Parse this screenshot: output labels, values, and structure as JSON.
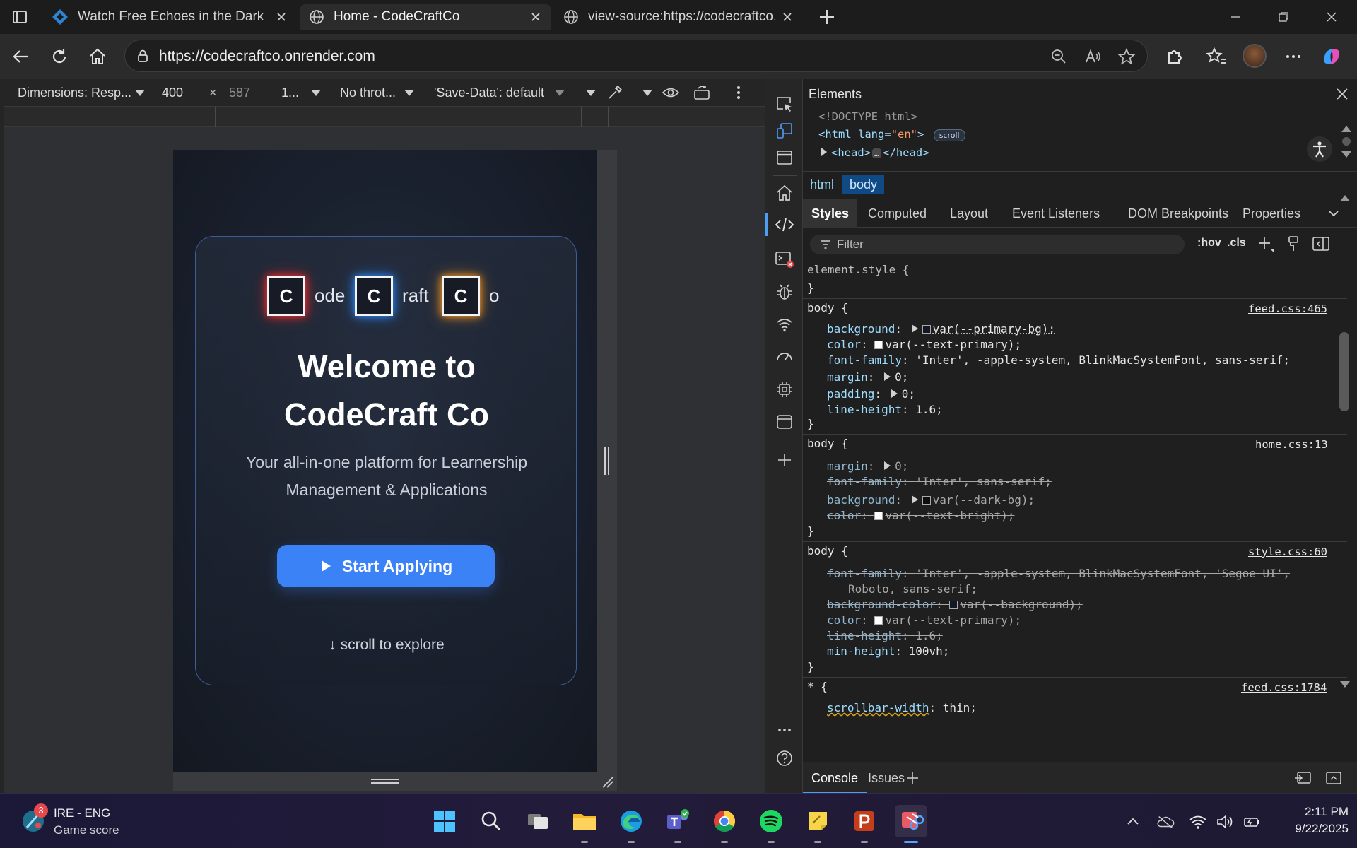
{
  "browser": {
    "tabs": [
      {
        "title": "Watch Free Echoes in the Dark Fu",
        "active": false
      },
      {
        "title": "Home - CodeCraftCo",
        "active": true
      },
      {
        "title": "view-source:https://codecraftco.o",
        "active": false
      }
    ],
    "url": "https://codecraftco.onrender.com"
  },
  "emulation": {
    "dimensions_label": "Dimensions: Resp...",
    "width": "400",
    "times": "×",
    "height": "587",
    "zoom": "1...",
    "throttle": "No throt...",
    "save_data": "'Save-Data': default"
  },
  "page": {
    "logo": [
      {
        "letter": "C",
        "rest": "ode",
        "glow": "#ff2b2b"
      },
      {
        "letter": "C",
        "rest": "raft",
        "glow": "#2b8bff"
      },
      {
        "letter": "C",
        "rest": "o",
        "glow": "#ff9a1f"
      }
    ],
    "headline_1": "Welcome to",
    "headline_2": "CodeCraft Co",
    "subtitle": "Your all-in-one platform for Learnership Management & Applications",
    "cta_label": "Start Applying",
    "scroll_hint": "↓ scroll to explore",
    "accent": "#3b82f6"
  },
  "devtools": {
    "panel_title": "Elements",
    "dom": {
      "doctype": "<!DOCTYPE html>",
      "html_open": "<html",
      "html_attr_name": "lang",
      "html_attr_value": "\"en\"",
      "html_close": ">",
      "scroll_badge": "scroll",
      "head_open": "<head>",
      "head_ellipsis": "…",
      "head_close": "</head>"
    },
    "breadcrumbs": [
      "html",
      "body"
    ],
    "subtabs": [
      "Styles",
      "Computed",
      "Layout",
      "Event Listeners",
      "DOM Breakpoints",
      "Properties"
    ],
    "filter_placeholder": "Filter",
    "hov": ":hov",
    "cls": ".cls",
    "element_style": "element.style {",
    "close_brace": "}",
    "rules": [
      {
        "selector": "body {",
        "source": "feed.css:465",
        "decls": [
          {
            "name": "background",
            "value": "var(--primary-bg);",
            "swatch": "#121826",
            "expand": true
          },
          {
            "name": "color",
            "value": "var(--text-primary);",
            "swatch": "#ffffff"
          },
          {
            "name": "font-family",
            "value": "'Inter', -apple-system, BlinkMacSystemFont, sans-serif;"
          },
          {
            "name": "margin",
            "value": "0;",
            "expand": true
          },
          {
            "name": "padding",
            "value": "0;",
            "expand": true
          },
          {
            "name": "line-height",
            "value": "1.6;"
          }
        ]
      },
      {
        "selector": "body {",
        "source": "home.css:13",
        "decls": [
          {
            "name": "margin",
            "value": "0;",
            "expand": true,
            "struck": true
          },
          {
            "name": "font-family",
            "value": "'Inter', sans-serif;",
            "struck": true
          },
          {
            "name": "background",
            "value": "var(--dark-bg);",
            "swatch": "#0e0e0e",
            "expand": true,
            "struck": true
          },
          {
            "name": "color",
            "value": "var(--text-bright);",
            "swatch": "#ffffff",
            "struck": true
          }
        ]
      },
      {
        "selector": "body {",
        "source": "style.css:60",
        "decls": [
          {
            "name": "font-family",
            "value": "'Inter', -apple-system, BlinkMacSystemFont, 'Segoe UI',",
            "struck": true
          },
          {
            "name": "",
            "value": "Roboto, sans-serif;",
            "struck": true,
            "continuation": true
          },
          {
            "name": "background-color",
            "value": "var(--background);",
            "swatch": "#121826",
            "struck": true
          },
          {
            "name": "color",
            "value": "var(--text-primary);",
            "swatch": "#ffffff",
            "struck": true
          },
          {
            "name": "line-height",
            "value": "1.6;",
            "struck": true
          },
          {
            "name": "min-height",
            "value": "100vh;"
          }
        ]
      },
      {
        "selector": "* {",
        "source": "feed.css:1784",
        "decls": [
          {
            "name": "scrollbar-width",
            "value": "thin;"
          }
        ]
      }
    ],
    "drawer_tabs": [
      "Console",
      "Issues"
    ]
  },
  "taskbar": {
    "weather_badge": "3",
    "weather_title": "IRE - ENG",
    "weather_sub": "Game score",
    "time": "2:11 PM",
    "date": "9/22/2025"
  }
}
